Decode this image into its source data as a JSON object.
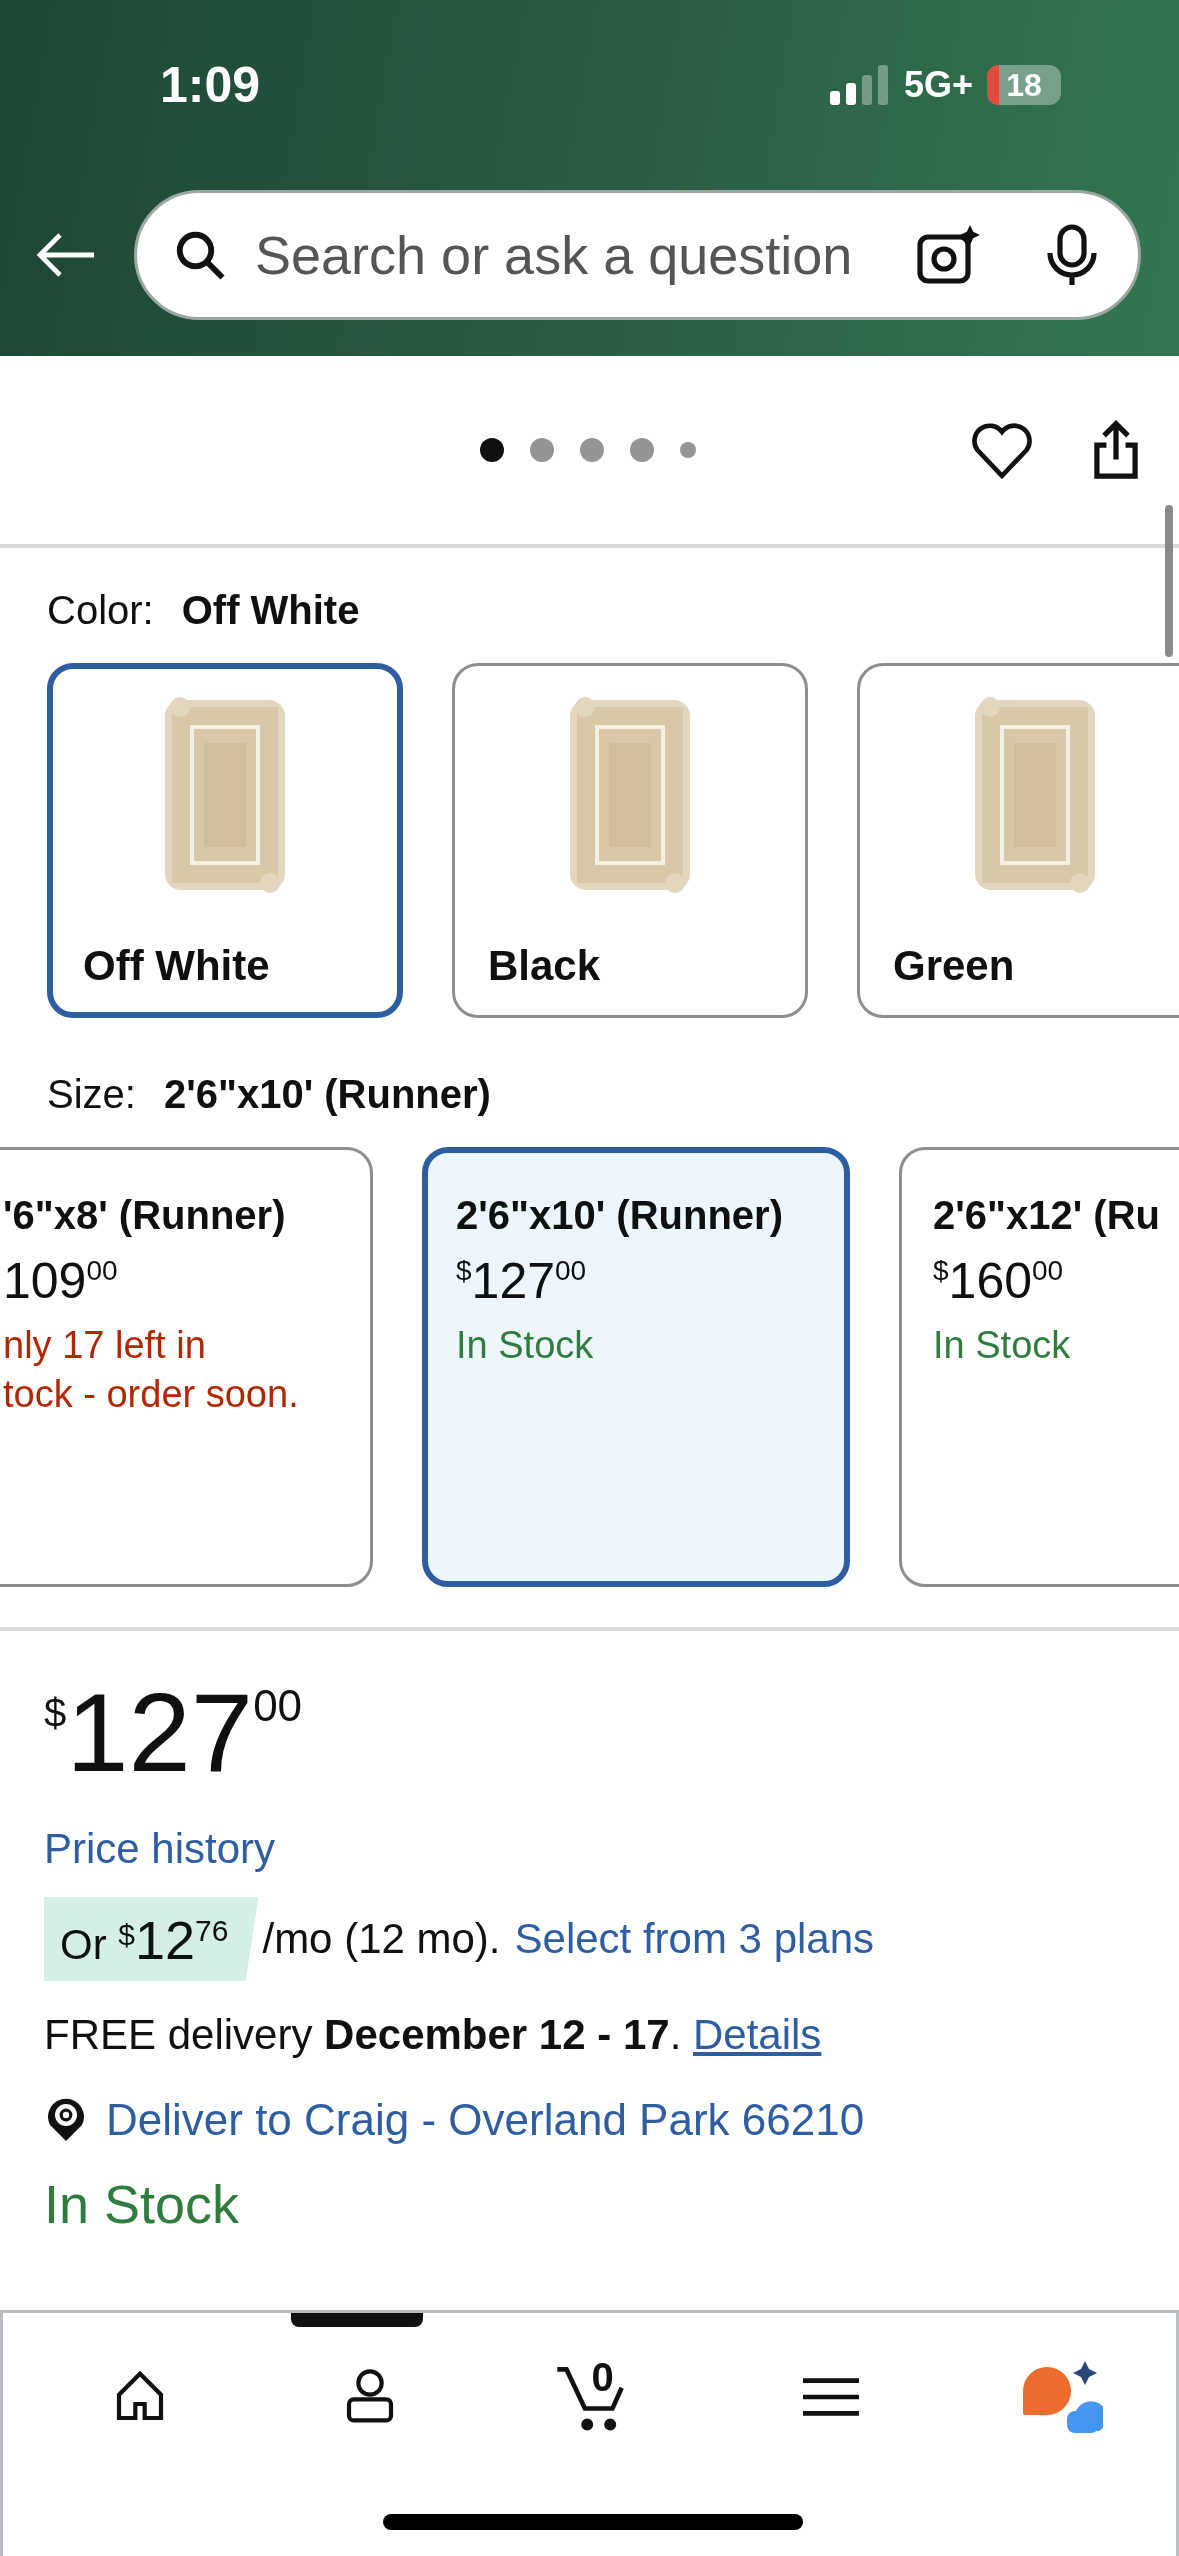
{
  "status_bar": {
    "time": "1:09",
    "network": "5G+",
    "battery": "18"
  },
  "search": {
    "placeholder": "Search or ask a question"
  },
  "gallery": {
    "dots": [
      {
        "selected": true
      },
      {
        "selected": false
      },
      {
        "selected": false
      },
      {
        "selected": false
      },
      {
        "selected": false
      }
    ]
  },
  "color": {
    "label": "Color:",
    "value": "Off White",
    "swatches": [
      {
        "label": "Off White",
        "selected": true,
        "kind": "picture"
      },
      {
        "label": "Black",
        "selected": false,
        "kind": "picture"
      },
      {
        "label": "Green",
        "selected": false,
        "kind": "picture"
      }
    ]
  },
  "size": {
    "label": "Size:",
    "value": "2'6\"x10' (Runner)",
    "options": [
      {
        "title": "'6\"x8' (Runner)",
        "price": {
          "whole": "109",
          "fraction": "00"
        },
        "stock": [
          "nly 17 left in",
          "tock - order soon."
        ],
        "low_stock": true,
        "selected": false
      },
      {
        "title": "2'6\"x10' (Runner)",
        "price": {
          "symbol": "$",
          "whole": "127",
          "fraction": "00"
        },
        "stock": [
          "In Stock"
        ],
        "low_stock": false,
        "selected": true
      },
      {
        "title": "2'6\"x12' (Ru",
        "price": {
          "symbol": "$",
          "whole": "160",
          "fraction": "00"
        },
        "stock": [
          "In Stock"
        ],
        "low_stock": false,
        "selected": false
      }
    ]
  },
  "price": {
    "symbol": "$",
    "whole": "127",
    "fraction": "00"
  },
  "price_history": "Price history",
  "installment": {
    "prefix": "Or",
    "symbol": "$",
    "whole": "12",
    "fraction": "76",
    "terms": "/mo (12 mo).",
    "link": "Select from 3 plans"
  },
  "delivery": {
    "text": "FREE delivery **December 12 - 17**.",
    "link": "Details"
  },
  "deliver_to": "Deliver to Craig - Overland Park 66210",
  "availability": "In Stock",
  "nav": [
    {
      "kind": "home"
    },
    {
      "kind": "account"
    },
    {
      "kind": "cart",
      "count": "0"
    },
    {
      "kind": "menu"
    },
    {
      "kind": "assistant"
    }
  ]
}
